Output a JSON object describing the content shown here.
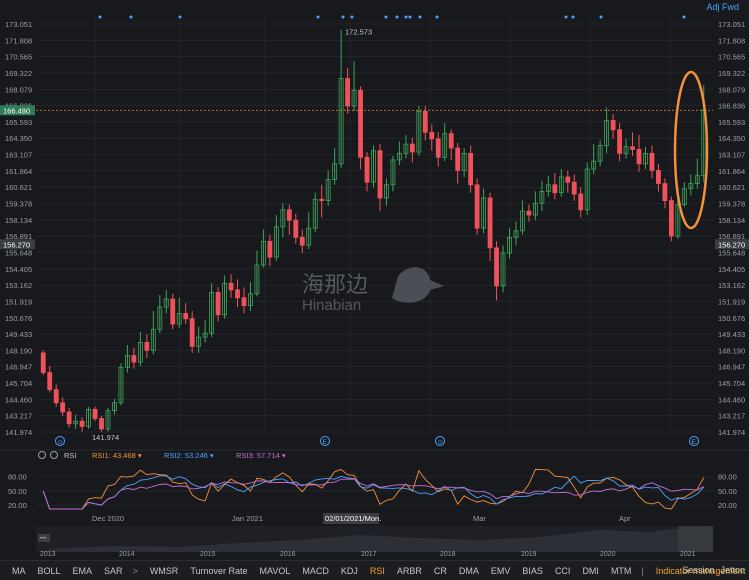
{
  "header": {
    "adj_label": "Adj Fwd"
  },
  "colors": {
    "up": "#3fa35a",
    "down": "#f0525b",
    "bg": "#17191d",
    "grid": "#2a2d33",
    "highlight": "#f5913a",
    "dots": "#4ea1ff"
  },
  "chart_data": {
    "type": "candlestick",
    "yticks_left": [
      "173.051",
      "171.808",
      "170.565",
      "169.322",
      "168.079",
      "166.836",
      "165.593",
      "164.350",
      "163.107",
      "161.864",
      "160.621",
      "159.378",
      "158.134",
      "156.891",
      "155.648",
      "154.405",
      "153.162",
      "151.919",
      "150.676",
      "149.433",
      "148.190",
      "146.947",
      "145.704",
      "144.460",
      "143.217",
      "141.974"
    ],
    "yticks_right": [
      "173.051",
      "171.808",
      "170.565",
      "169.322",
      "168.079",
      "166.836",
      "165.593",
      "164.350",
      "163.107",
      "161.864",
      "160.621",
      "159.378",
      "158.134",
      "156.891",
      "155.648",
      "154.405",
      "153.162",
      "151.919",
      "150.676",
      "149.433",
      "148.190",
      "146.947",
      "145.704",
      "144.460",
      "143.217",
      "141.974"
    ],
    "ylim": [
      141.974,
      173.051
    ],
    "high_annotation": "172.573",
    "low_annotation": "141.974",
    "price_line_left": "166.480",
    "price_line_right": "166.836",
    "last_price_label": "156.270",
    "candles": [
      [
        148.0,
        146.5,
        148.2,
        146.3
      ],
      [
        146.5,
        145.2,
        147.0,
        145.0
      ],
      [
        145.2,
        144.2,
        145.6,
        143.9
      ],
      [
        144.2,
        143.5,
        144.6,
        143.2
      ],
      [
        143.5,
        142.6,
        143.8,
        142.3
      ],
      [
        142.6,
        142.8,
        143.3,
        142.2
      ],
      [
        142.8,
        142.4,
        143.1,
        142.0
      ],
      [
        142.4,
        143.7,
        143.9,
        142.2
      ],
      [
        143.7,
        143.0,
        143.9,
        142.8
      ],
      [
        143.0,
        142.2,
        143.2,
        142.0
      ],
      [
        142.2,
        143.6,
        143.8,
        142.0
      ],
      [
        143.6,
        144.2,
        144.5,
        143.3
      ],
      [
        144.2,
        146.9,
        147.2,
        144.0
      ],
      [
        146.9,
        147.8,
        148.6,
        146.5
      ],
      [
        147.8,
        147.3,
        148.4,
        146.8
      ],
      [
        147.3,
        148.8,
        149.6,
        147.0
      ],
      [
        148.8,
        148.2,
        149.4,
        147.6
      ],
      [
        148.2,
        149.8,
        151.2,
        147.9
      ],
      [
        149.8,
        151.5,
        152.4,
        149.5
      ],
      [
        151.5,
        152.1,
        152.8,
        151.0
      ],
      [
        152.1,
        150.2,
        152.5,
        149.8
      ],
      [
        150.2,
        151.0,
        152.2,
        149.9
      ],
      [
        151.0,
        150.6,
        151.8,
        150.2
      ],
      [
        150.6,
        148.5,
        151.2,
        148.0
      ],
      [
        148.5,
        149.2,
        150.0,
        148.0
      ],
      [
        149.2,
        149.5,
        150.5,
        148.8
      ],
      [
        149.5,
        152.6,
        153.3,
        149.2
      ],
      [
        152.6,
        150.9,
        153.0,
        150.4
      ],
      [
        150.9,
        153.3,
        153.9,
        150.6
      ],
      [
        153.3,
        152.8,
        154.0,
        152.2
      ],
      [
        152.8,
        152.2,
        153.6,
        151.5
      ],
      [
        152.2,
        151.6,
        153.0,
        151.0
      ],
      [
        151.6,
        152.5,
        153.4,
        151.2
      ],
      [
        152.5,
        154.7,
        155.8,
        152.3
      ],
      [
        154.7,
        156.5,
        157.4,
        154.5
      ],
      [
        156.5,
        155.3,
        157.0,
        154.6
      ],
      [
        155.3,
        157.6,
        158.5,
        155.0
      ],
      [
        157.6,
        158.9,
        159.4,
        156.8
      ],
      [
        158.9,
        158.1,
        159.3,
        157.0
      ],
      [
        158.1,
        156.8,
        158.6,
        156.3
      ],
      [
        156.8,
        156.2,
        157.4,
        155.6
      ],
      [
        156.2,
        157.5,
        158.7,
        155.9
      ],
      [
        157.5,
        159.7,
        160.2,
        157.2
      ],
      [
        159.7,
        159.6,
        160.8,
        158.3
      ],
      [
        159.6,
        161.2,
        161.9,
        159.2
      ],
      [
        161.2,
        162.4,
        163.6,
        160.8
      ],
      [
        162.4,
        168.9,
        172.6,
        162.1
      ],
      [
        168.9,
        166.8,
        169.7,
        166.2
      ],
      [
        166.8,
        168.0,
        170.2,
        166.4
      ],
      [
        168.0,
        162.9,
        168.3,
        162.0
      ],
      [
        162.9,
        161.0,
        163.3,
        160.3
      ],
      [
        161.0,
        163.4,
        163.8,
        160.6
      ],
      [
        163.4,
        159.8,
        163.9,
        158.8
      ],
      [
        159.8,
        160.8,
        161.3,
        159.2
      ],
      [
        160.8,
        162.7,
        163.0,
        160.3
      ],
      [
        162.7,
        163.2,
        164.1,
        162.3
      ],
      [
        163.2,
        163.9,
        164.6,
        162.8
      ],
      [
        163.9,
        163.3,
        164.4,
        162.5
      ],
      [
        163.3,
        166.4,
        166.8,
        163.0
      ],
      [
        166.4,
        164.8,
        166.8,
        164.2
      ],
      [
        164.8,
        164.3,
        165.4,
        163.4
      ],
      [
        164.3,
        162.9,
        164.8,
        162.2
      ],
      [
        162.9,
        164.7,
        165.5,
        162.6
      ],
      [
        164.7,
        163.6,
        165.0,
        162.7
      ],
      [
        163.6,
        161.9,
        164.0,
        160.9
      ],
      [
        161.9,
        163.2,
        163.6,
        161.4
      ],
      [
        163.2,
        160.8,
        163.8,
        160.2
      ],
      [
        160.8,
        157.5,
        161.3,
        157.0
      ],
      [
        157.5,
        159.8,
        160.5,
        157.1
      ],
      [
        159.8,
        156.0,
        160.2,
        155.0
      ],
      [
        156.0,
        153.1,
        156.5,
        152.0
      ],
      [
        153.1,
        155.6,
        156.2,
        152.6
      ],
      [
        155.6,
        156.8,
        157.5,
        155.2
      ],
      [
        156.8,
        157.3,
        158.0,
        156.2
      ],
      [
        157.3,
        158.8,
        159.6,
        157.0
      ],
      [
        158.8,
        158.5,
        159.3,
        158.0
      ],
      [
        158.5,
        159.4,
        160.3,
        158.1
      ],
      [
        159.4,
        160.3,
        161.1,
        158.8
      ],
      [
        160.3,
        160.8,
        161.5,
        159.9
      ],
      [
        160.8,
        160.2,
        161.7,
        159.7
      ],
      [
        160.2,
        161.4,
        162.0,
        159.9
      ],
      [
        161.4,
        161.0,
        161.9,
        160.2
      ],
      [
        161.0,
        160.1,
        161.6,
        159.6
      ],
      [
        160.1,
        158.9,
        160.6,
        158.3
      ],
      [
        158.9,
        162.0,
        162.5,
        158.5
      ],
      [
        162.0,
        162.6,
        163.9,
        161.6
      ],
      [
        162.6,
        163.8,
        164.2,
        162.2
      ],
      [
        163.8,
        165.7,
        166.7,
        163.2
      ],
      [
        165.7,
        165.0,
        166.2,
        164.3
      ],
      [
        165.0,
        163.2,
        165.5,
        162.6
      ],
      [
        163.2,
        163.7,
        164.3,
        162.8
      ],
      [
        163.7,
        163.5,
        164.8,
        163.0
      ],
      [
        163.5,
        162.4,
        164.6,
        161.8
      ],
      [
        162.4,
        163.2,
        163.7,
        162.0
      ],
      [
        163.2,
        161.9,
        163.8,
        161.3
      ],
      [
        161.9,
        160.9,
        162.4,
        160.3
      ],
      [
        160.9,
        159.6,
        161.3,
        159.0
      ],
      [
        159.6,
        156.9,
        159.9,
        156.5
      ],
      [
        156.9,
        159.3,
        159.7,
        156.7
      ],
      [
        159.3,
        160.5,
        161.0,
        159.1
      ],
      [
        160.5,
        160.9,
        161.6,
        160.0
      ],
      [
        160.9,
        161.5,
        162.8,
        160.5
      ],
      [
        161.5,
        166.5,
        168.4,
        161.0
      ]
    ],
    "rsi": {
      "label": "RSI",
      "series": [
        {
          "name": "RSI1: 43.468",
          "color": "#f5913a"
        },
        {
          "name": "RSI2: 53.246",
          "color": "#4ea1ff"
        },
        {
          "name": "RSI3: 57.714",
          "color": "#c86dd7"
        }
      ],
      "yticks": [
        "80.00",
        "50.00",
        "20.00"
      ]
    },
    "x_labels": [
      "Dec 2020",
      "Jan 2021",
      "02/01/2021/Mon.",
      "Mar",
      "Apr"
    ],
    "overview_years": [
      "2013",
      "2014",
      "2015",
      "2016",
      "2017",
      "2018",
      "2019",
      "2020",
      "2021"
    ]
  },
  "toolbar": {
    "items": [
      "MA",
      "BOLL",
      "EMA",
      "SAR"
    ],
    "items2": [
      "WMSR",
      "Turnover Rate",
      "MAVOL",
      "MACD",
      "KDJ",
      "RSI",
      "ARBR",
      "CR",
      "DMA",
      "EMV",
      "BIAS",
      "CCI",
      "DMI",
      "MTM"
    ],
    "separator": ">",
    "management": "Indicator management",
    "right": [
      "Session",
      "Jetton"
    ]
  },
  "watermark": {
    "cn": "海那边",
    "en": "Hinabian"
  }
}
